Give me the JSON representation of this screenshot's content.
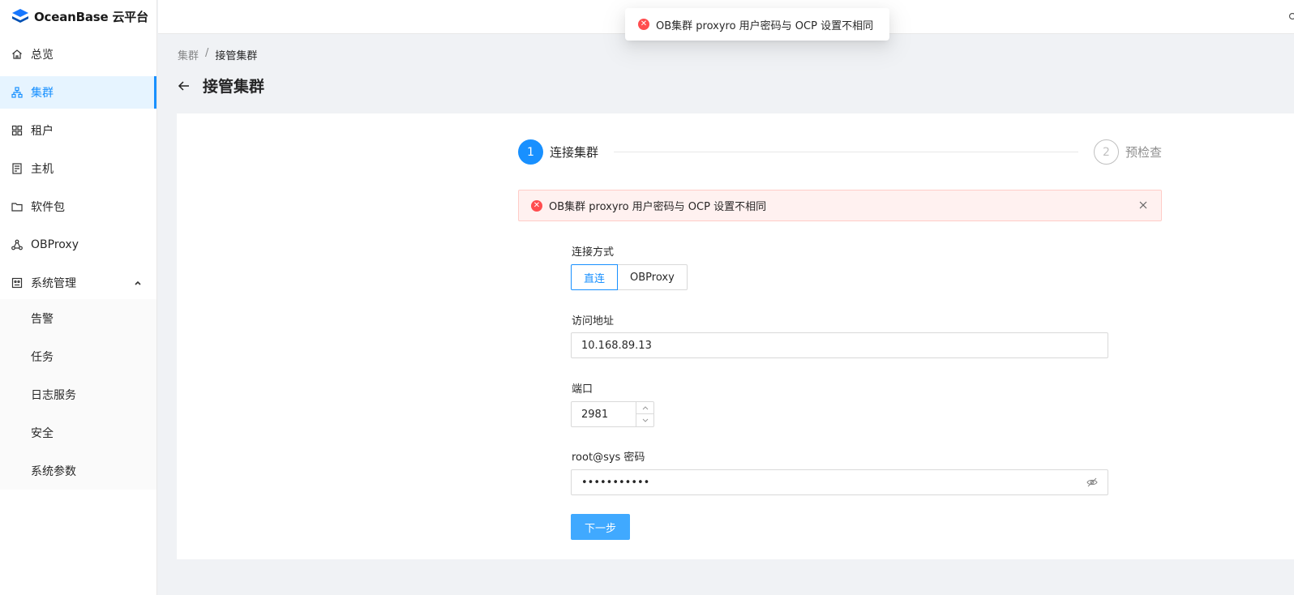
{
  "brand": {
    "name": "OceanBase 云平台",
    "color": "#1890ff"
  },
  "sidebar": {
    "items": [
      {
        "label": "总览",
        "icon": "home-icon"
      },
      {
        "label": "集群",
        "icon": "cluster-icon",
        "active": true
      },
      {
        "label": "租户",
        "icon": "tenant-grid-icon"
      },
      {
        "label": "主机",
        "icon": "host-icon"
      },
      {
        "label": "软件包",
        "icon": "folder-icon"
      },
      {
        "label": "OBProxy",
        "icon": "proxy-icon"
      },
      {
        "label": "系统管理",
        "icon": "system-icon",
        "expanded": true
      }
    ],
    "submenu": [
      {
        "label": "告警"
      },
      {
        "label": "任务"
      },
      {
        "label": "日志服务"
      },
      {
        "label": "安全"
      },
      {
        "label": "系统参数"
      }
    ]
  },
  "toast": {
    "message": "OB集群 proxyro 用户密码与 OCP 设置不相同"
  },
  "breadcrumb": {
    "parent": "集群",
    "separator": "/",
    "current": "接管集群"
  },
  "page": {
    "title": "接管集群"
  },
  "steps": [
    {
      "number": "1",
      "label": "连接集群",
      "status": "active"
    },
    {
      "number": "2",
      "label": "预检查",
      "status": "wait"
    }
  ],
  "alert": {
    "message": "OB集群 proxyro 用户密码与 OCP 设置不相同"
  },
  "form": {
    "connection_mode": {
      "label": "连接方式",
      "options": [
        "直连",
        "OBProxy"
      ],
      "selected": "直连"
    },
    "address": {
      "label": "访问地址",
      "value": "10.168.89.13"
    },
    "port": {
      "label": "端口",
      "value": "2981"
    },
    "password": {
      "label": "root@sys 密码",
      "masked_value": "•••••••••••"
    },
    "next_label": "下一步"
  }
}
